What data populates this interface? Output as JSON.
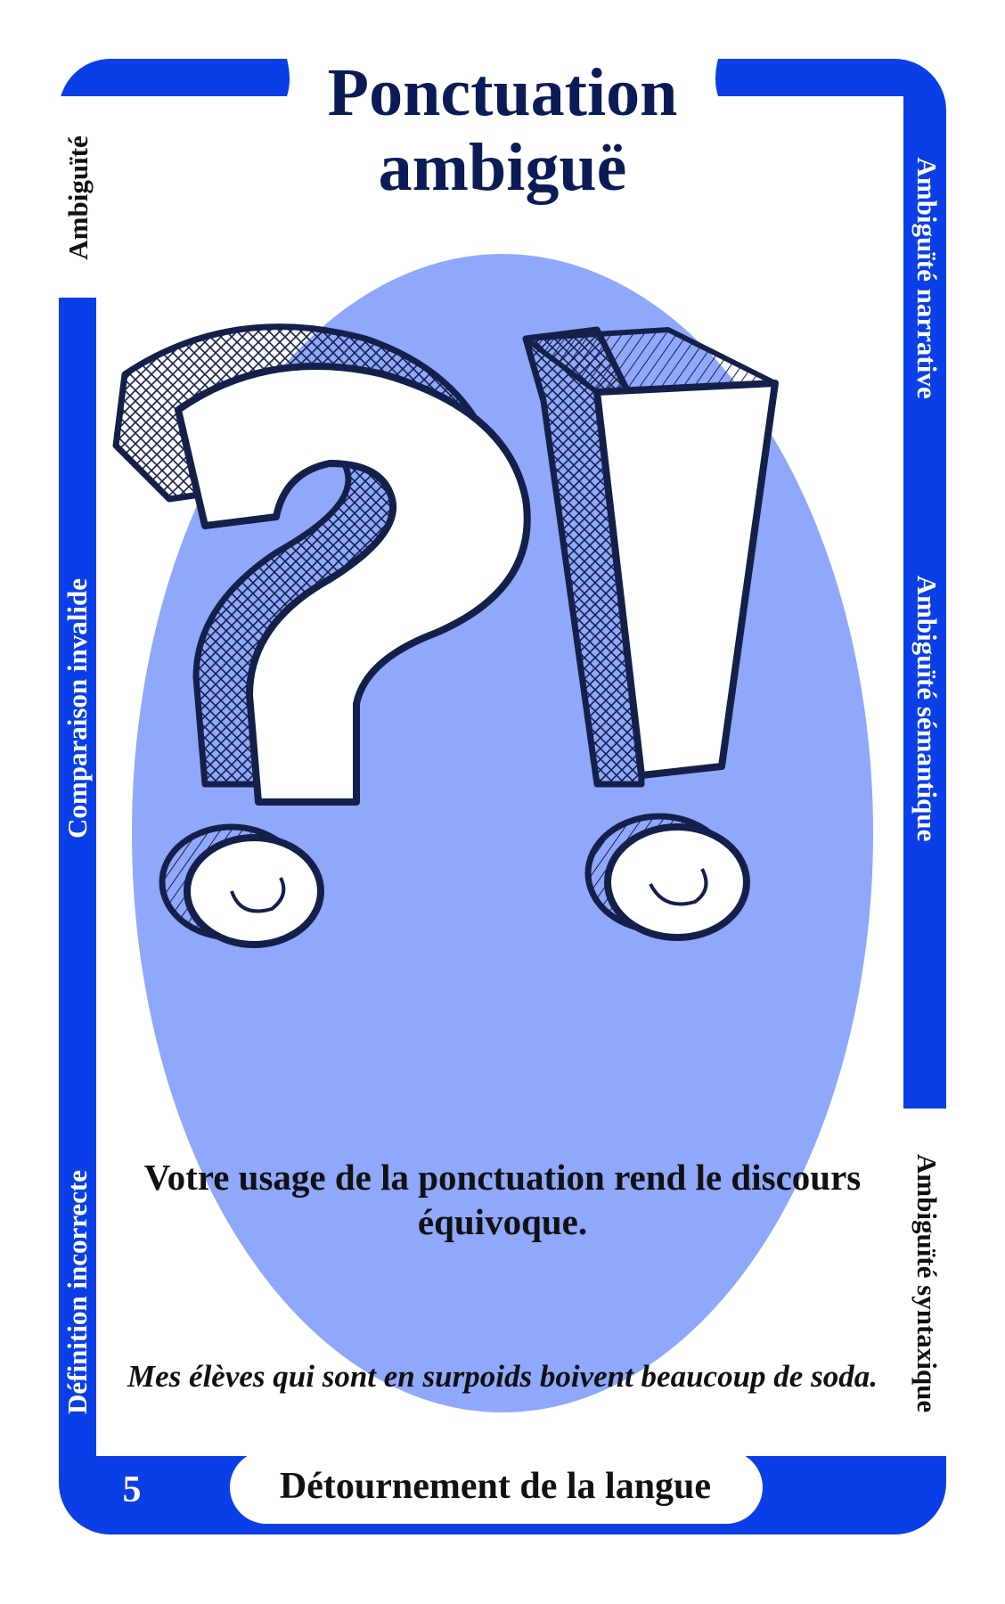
{
  "card": {
    "title": "Ponctuation ambiguë",
    "description": "Votre usage de la ponctuation rend le discours équivoque.",
    "example": "Mes élèves qui sont en surpoids boivent beaucoup de soda.",
    "number": "5",
    "category": "Détournement de la langue"
  },
  "side_labels": {
    "left_top": "Ambiguïté",
    "left_middle": "Comparaison invalide",
    "left_bottom": "Définition incorrecte",
    "right_top": "Ambiguïté narrative",
    "right_middle": "Ambiguïté sémantique",
    "right_bottom": "Ambiguïté syntaxique"
  },
  "illustration": {
    "icons": [
      "question-mark-icon",
      "exclamation-mark-icon"
    ]
  },
  "colors": {
    "frame_blue": "#0a3ee6",
    "oval_blue": "#8fa8fb",
    "title_navy": "#0b1b55",
    "ink": "#14204a"
  }
}
